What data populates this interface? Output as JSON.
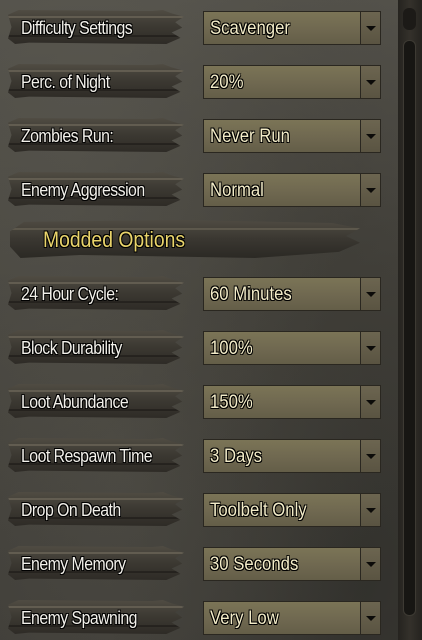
{
  "settings_top": [
    {
      "label": "Difficulty Settings",
      "value": "Scavenger"
    },
    {
      "label": "Perc. of Night",
      "value": "20%"
    },
    {
      "label": "Zombies Run:",
      "value": "Never Run"
    },
    {
      "label": "Enemy Aggression",
      "value": "Normal"
    }
  ],
  "section_header": "Modded Options",
  "settings_modded": [
    {
      "label": "24 Hour Cycle:",
      "value": "60 Minutes"
    },
    {
      "label": "Block Durability",
      "value": "100%"
    },
    {
      "label": "Loot Abundance",
      "value": "150%"
    },
    {
      "label": "Loot Respawn Time",
      "value": "3 Days"
    },
    {
      "label": "Drop On Death",
      "value": "Toolbelt Only"
    },
    {
      "label": "Enemy Memory",
      "value": "30 Seconds"
    },
    {
      "label": "Enemy Spawning",
      "value": "Very Low"
    }
  ],
  "icons": {
    "dropdown": "chevron-down-icon"
  }
}
